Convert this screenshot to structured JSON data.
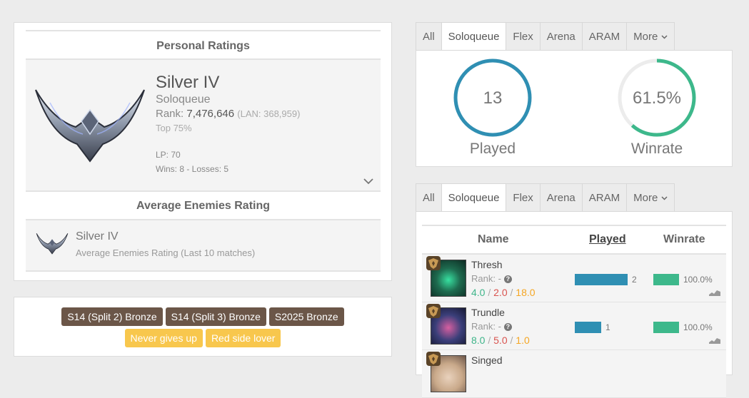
{
  "personal_ratings": {
    "title": "Personal Ratings",
    "tier": "Silver IV",
    "queue": "Soloqueue",
    "rank_label": "Rank: ",
    "rank_value": "7,476,646",
    "rank_region": "(LAN: 368,959)",
    "top_percent": "Top 75%",
    "lp": "LP: 70",
    "wins_losses": "Wins: 8 - Losses: 5",
    "expand_icon": "chevron-down-icon"
  },
  "average_enemies": {
    "title": "Average Enemies Rating",
    "tier": "Silver IV",
    "description": "Average Enemies Rating (Last 10 matches)"
  },
  "badges": {
    "brown": [
      "S14 (Split 2) Bronze",
      "S14 (Split 3) Bronze",
      "S2025 Bronze"
    ],
    "gold": [
      "Never gives up",
      "Red side lover"
    ],
    "colors": {
      "brown": "#6b5648",
      "gold": "#f8c74d"
    }
  },
  "queue_tabs_top": {
    "items": [
      "All",
      "Soloqueue",
      "Flex",
      "Arena",
      "ARAM",
      "More"
    ],
    "active": "Soloqueue"
  },
  "stats": {
    "played_value": "13",
    "played_label": "Played",
    "played_ring_fraction": 1.0,
    "winrate_value": "61.5%",
    "winrate_label": "Winrate",
    "winrate_ring_fraction": 0.615,
    "colors": {
      "played": "#2f8fb3",
      "winrate": "#3db88b",
      "track": "#ececec"
    }
  },
  "queue_tabs_bottom": {
    "items": [
      "All",
      "Soloqueue",
      "Flex",
      "Arena",
      "ARAM",
      "More"
    ],
    "active": "Soloqueue"
  },
  "champions_table": {
    "headers": {
      "name": "Name",
      "played": "Played",
      "winrate": "Winrate"
    },
    "rows": [
      {
        "name": "Thresh",
        "rank": "Rank: -",
        "kills": "4.0",
        "deaths": "2.0",
        "assists": "18.0",
        "played": "2",
        "played_fraction": 1.0,
        "winrate": "100.0%",
        "portrait_color": "#1e6b4f"
      },
      {
        "name": "Trundle",
        "rank": "Rank: -",
        "kills": "8.0",
        "deaths": "5.0",
        "assists": "1.0",
        "played": "1",
        "played_fraction": 0.5,
        "winrate": "100.0%",
        "portrait_color": "#3b3f7a"
      },
      {
        "name": "Singed",
        "portrait_color": "#c9a98a"
      }
    ]
  },
  "separator": "/"
}
